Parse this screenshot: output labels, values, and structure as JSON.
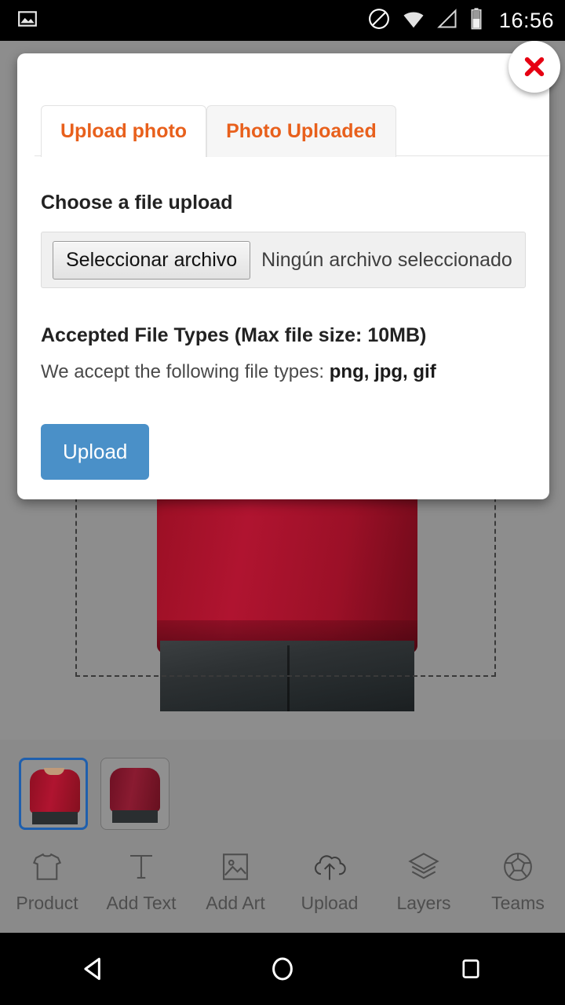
{
  "status_bar": {
    "time": "16:56",
    "icons": [
      "photo-icon",
      "do-not-disturb-icon",
      "wifi-icon",
      "cell-signal-icon",
      "battery-icon"
    ]
  },
  "modal": {
    "close_label": "×",
    "tabs": [
      {
        "label": "Upload photo",
        "active": true
      },
      {
        "label": "Photo Uploaded",
        "active": false
      }
    ],
    "choose_file_label": "Choose a file upload",
    "file_input": {
      "button_label": "Seleccionar archivo",
      "file_name": "Ningún archivo seleccionado"
    },
    "accepted_title": "Accepted File Types (Max file size: 10MB)",
    "accepted_prefix": "We accept the following file types: ",
    "accepted_types": "png, jpg, gif",
    "upload_button": "Upload",
    "accent_orange": "#e8601c",
    "button_blue": "#4a90c8"
  },
  "thumbnails": [
    {
      "name": "front-view",
      "selected": true
    },
    {
      "name": "back-view",
      "selected": false
    }
  ],
  "toolbar": {
    "items": [
      {
        "label": "Product",
        "icon": "tshirt-icon"
      },
      {
        "label": "Add Text",
        "icon": "text-t-icon"
      },
      {
        "label": "Add Art",
        "icon": "image-icon"
      },
      {
        "label": "Upload",
        "icon": "cloud-upload-icon"
      },
      {
        "label": "Layers",
        "icon": "layers-icon"
      },
      {
        "label": "Teams",
        "icon": "soccer-ball-icon"
      }
    ]
  },
  "nav_bar": {
    "buttons": [
      {
        "name": "back-button",
        "icon": "triangle-back-icon"
      },
      {
        "name": "home-button",
        "icon": "circle-home-icon"
      },
      {
        "name": "recents-button",
        "icon": "square-recents-icon"
      }
    ]
  }
}
